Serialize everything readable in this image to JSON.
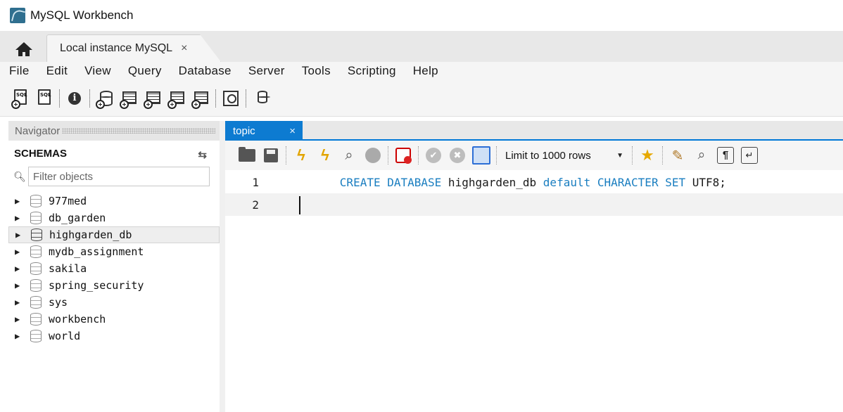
{
  "window": {
    "title": "MySQL Workbench"
  },
  "tabs": {
    "connection_label": "Local instance MySQL",
    "close_glyph": "×"
  },
  "menu": [
    "File",
    "Edit",
    "View",
    "Query",
    "Database",
    "Server",
    "Tools",
    "Scripting",
    "Help"
  ],
  "toolbar": {
    "new_sql_tab_icon_text": "SQL",
    "open_sql_icon_text": "SQL",
    "icons": [
      "new-sql-tab-icon",
      "open-sql-script-icon",
      "inspector-icon",
      "create-schema-icon",
      "create-table-icon",
      "create-view-icon",
      "create-procedure-icon",
      "create-function-icon",
      "search-table-data-icon",
      "reconnect-icon"
    ]
  },
  "navigator": {
    "header": "Navigator",
    "schemas_label": "SCHEMAS",
    "filter_placeholder": "Filter objects",
    "schemas": [
      "977med",
      "db_garden",
      "highgarden_db",
      "mydb_assignment",
      "sakila",
      "spring_security",
      "sys",
      "workbench",
      "world"
    ],
    "selected_schema": "highgarden_db"
  },
  "editor": {
    "tab_label": "topic",
    "tab_close": "×",
    "limit_select": "Limit to 1000 rows",
    "lines": [
      {
        "number": "1",
        "tokens": [
          {
            "text": "CREATE",
            "type": "kw"
          },
          {
            "text": " ",
            "type": "plain"
          },
          {
            "text": "DATABASE",
            "type": "kw"
          },
          {
            "text": " highgarden_db ",
            "type": "plain"
          },
          {
            "text": "default",
            "type": "kw"
          },
          {
            "text": " ",
            "type": "plain"
          },
          {
            "text": "CHARACTER",
            "type": "kw"
          },
          {
            "text": " ",
            "type": "plain"
          },
          {
            "text": "SET",
            "type": "kw"
          },
          {
            "text": " UTF8;",
            "type": "plain"
          }
        ]
      },
      {
        "number": "2",
        "tokens": []
      }
    ],
    "current_line": 2
  },
  "colors": {
    "accent": "#0d7bd1",
    "keyword": "#1a7ec0"
  }
}
